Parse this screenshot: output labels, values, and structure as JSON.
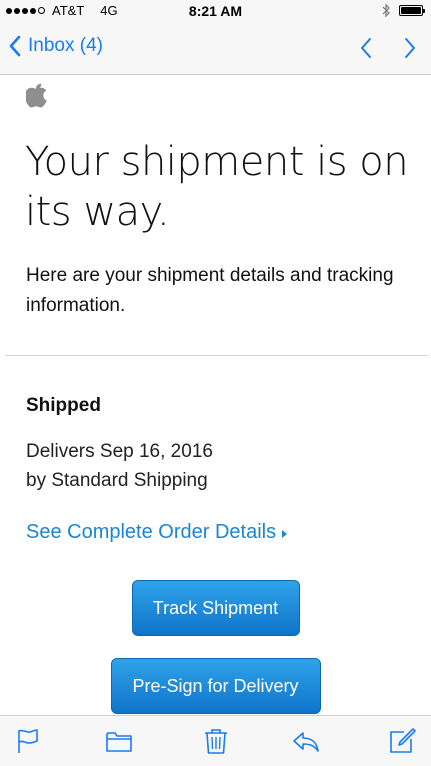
{
  "status_bar": {
    "carrier": "AT&T",
    "network": "4G",
    "time": "8:21 AM",
    "signal_bars": 4,
    "signal_max": 5,
    "battery_level": 1.0
  },
  "nav": {
    "back_label": "Inbox (4)",
    "icons": [
      "chevron-left-icon",
      "previous-message-icon",
      "next-message-icon"
    ],
    "accent_color": "#1a7cf0"
  },
  "email": {
    "headline": "Your shipment is on its way.",
    "intro": "Here are your shipment details and tracking information.",
    "status_heading": "Shipped",
    "delivery_date": "Delivers Sep 16, 2016",
    "delivery_method": "by Standard Shipping",
    "order_link": "See Complete Order Details",
    "link_color": "#1a86d0",
    "buttons": {
      "track": "Track Shipment",
      "presign": "Pre-Sign for Delivery"
    },
    "button_color": "#1a8ad8"
  },
  "toolbar": {
    "icons": [
      "flag-icon",
      "folder-icon",
      "trash-icon",
      "reply-icon",
      "compose-icon"
    ]
  }
}
